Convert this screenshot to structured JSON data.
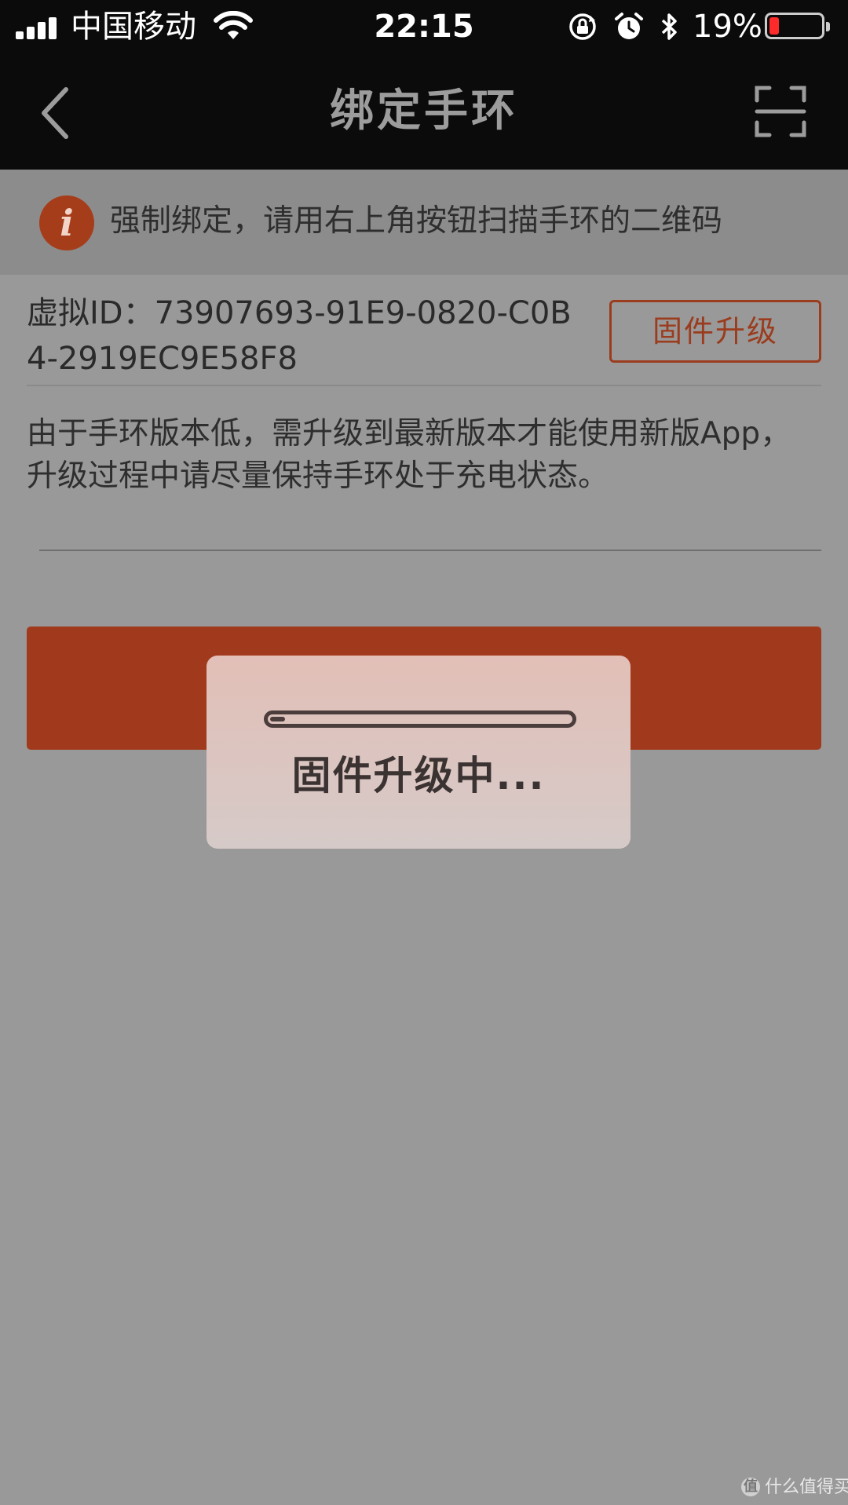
{
  "status_bar": {
    "carrier": "中国移动",
    "time": "22:15",
    "battery_percent": "19%",
    "battery_level": 0.19,
    "icons": [
      "signal-icon",
      "wifi-icon",
      "rotation-lock-icon",
      "alarm-icon",
      "bluetooth-icon",
      "battery-icon"
    ]
  },
  "nav": {
    "title": "绑定手环",
    "back_icon": "chevron-left-icon",
    "scan_icon": "scan-qr-icon"
  },
  "notice": {
    "icon": "info-icon",
    "icon_glyph": "i",
    "text": "强制绑定，请用右上角按钮扫描手环的二维码"
  },
  "device": {
    "virtual_id": "虚拟ID：73907693-91E9-0820-C0B4-2919EC9E58F8",
    "firmware_button": "固件升级",
    "upgrade_description": "由于手环版本低，需升级到最新版本才能使用新版App，升级过程中请尽量保持手环处于充电状态。"
  },
  "dialog": {
    "label": "固件升级中...",
    "progress": 0.05
  },
  "colors": {
    "accent": "#a13a1d",
    "header_bg": "#0b0b0b",
    "overlay": "#999999",
    "battery_low": "#ff2a2a"
  },
  "watermark": {
    "text": "什么值得买",
    "logo_glyph": "值"
  }
}
